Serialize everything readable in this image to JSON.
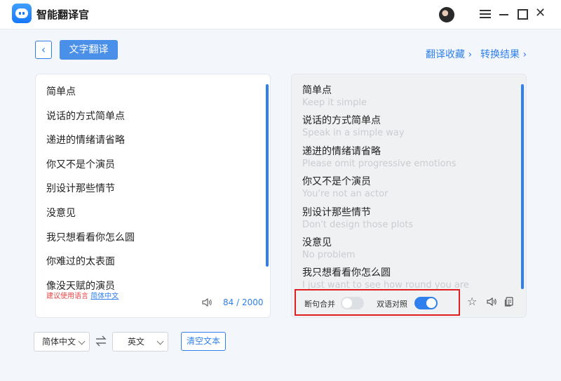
{
  "app": {
    "title": "智能翻译官"
  },
  "toolbar": {
    "back_label": "‹",
    "mode_label": "文字翻译",
    "favorites_link": "翻译收藏 ›",
    "results_link": "转换结果 ›"
  },
  "source": {
    "lines": [
      "简单点",
      "说话的方式简单点",
      "递进的情绪请省略",
      "你又不是个演员",
      "别设计那些情节",
      "没意见",
      "我只想看看你怎么圆",
      "你难过的太表面",
      "像没天赋的演员"
    ],
    "hint_label": "建议使用语言",
    "hint_link": "简体中文",
    "char_count": "84 / 2000"
  },
  "translation": {
    "items": [
      {
        "src": "简单点",
        "dst": "Keep it simple"
      },
      {
        "src": "说话的方式简单点",
        "dst": "Speak in a simple way"
      },
      {
        "src": "递进的情绪请省略",
        "dst": "Please omit progressive emotions"
      },
      {
        "src": "你又不是个演员",
        "dst": "You're not an actor"
      },
      {
        "src": "别设计那些情节",
        "dst": "Don't design those plots"
      },
      {
        "src": "没意见",
        "dst": "No problem"
      },
      {
        "src": "我只想看看你怎么圆",
        "dst": "I just want to see how round you are"
      }
    ],
    "options": {
      "merge_label": "断句合并",
      "merge_on": false,
      "bilingual_label": "双语对照",
      "bilingual_on": true
    }
  },
  "bottom": {
    "source_lang": "简体中文",
    "target_lang": "英文",
    "clear_label": "清空文本"
  },
  "colors": {
    "accent": "#2f80ed",
    "highlight_border": "#e02020"
  }
}
